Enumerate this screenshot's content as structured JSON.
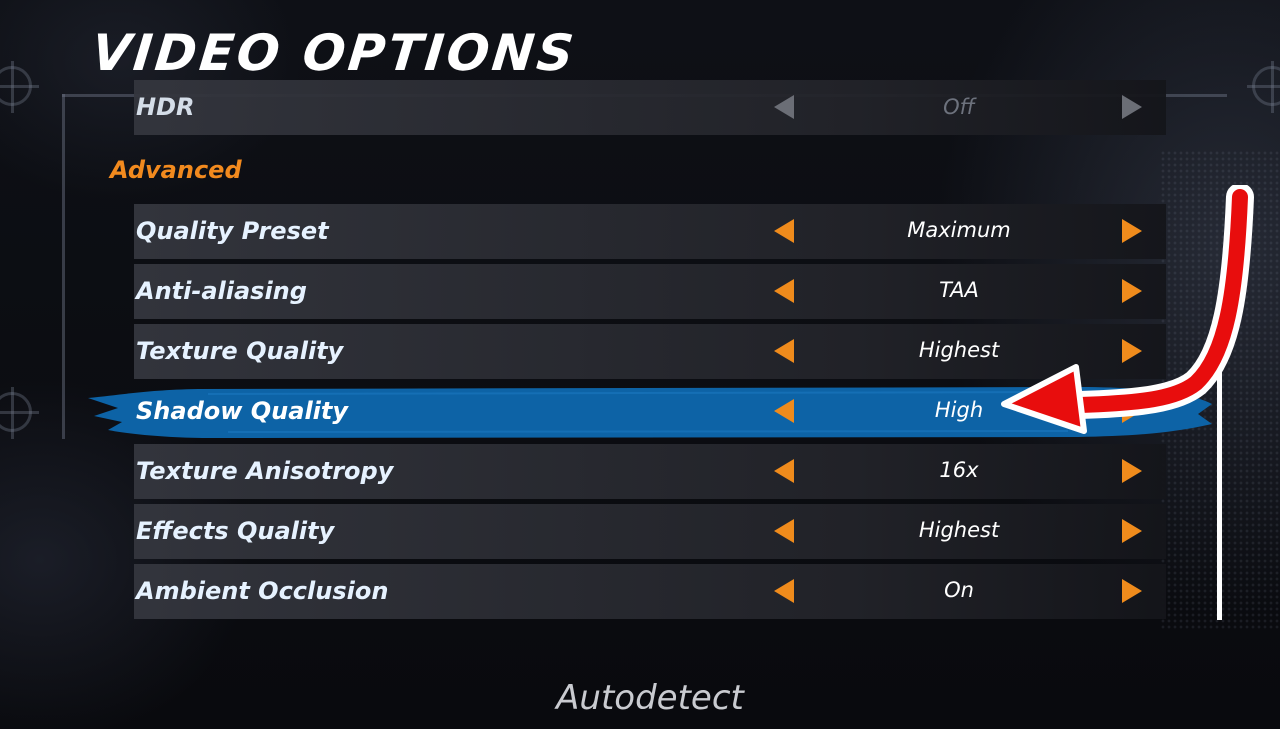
{
  "title": "VIDEO OPTIONS",
  "hdr_row": {
    "label": "HDR",
    "value": "Off"
  },
  "section_heading": "Advanced",
  "settings": [
    {
      "label": "Quality Preset",
      "value": "Maximum"
    },
    {
      "label": "Anti-aliasing",
      "value": "TAA"
    },
    {
      "label": "Texture Quality",
      "value": "Highest"
    },
    {
      "label": "Shadow Quality",
      "value": "High"
    },
    {
      "label": "Texture Anisotropy",
      "value": "16x"
    },
    {
      "label": "Effects Quality",
      "value": "Highest"
    },
    {
      "label": "Ambient Occlusion",
      "value": "On"
    }
  ],
  "selected_setting": "Shadow Quality",
  "autodetect_label": "Autodetect",
  "colors": {
    "accent_orange": "#ef8b1c",
    "selection_blue": "#0d63a6",
    "annotation_red": "#e80d0d"
  },
  "icons": {
    "decrease": "triangle-left-icon",
    "increase": "triangle-right-icon",
    "annotation": "red-arrow-icon"
  }
}
